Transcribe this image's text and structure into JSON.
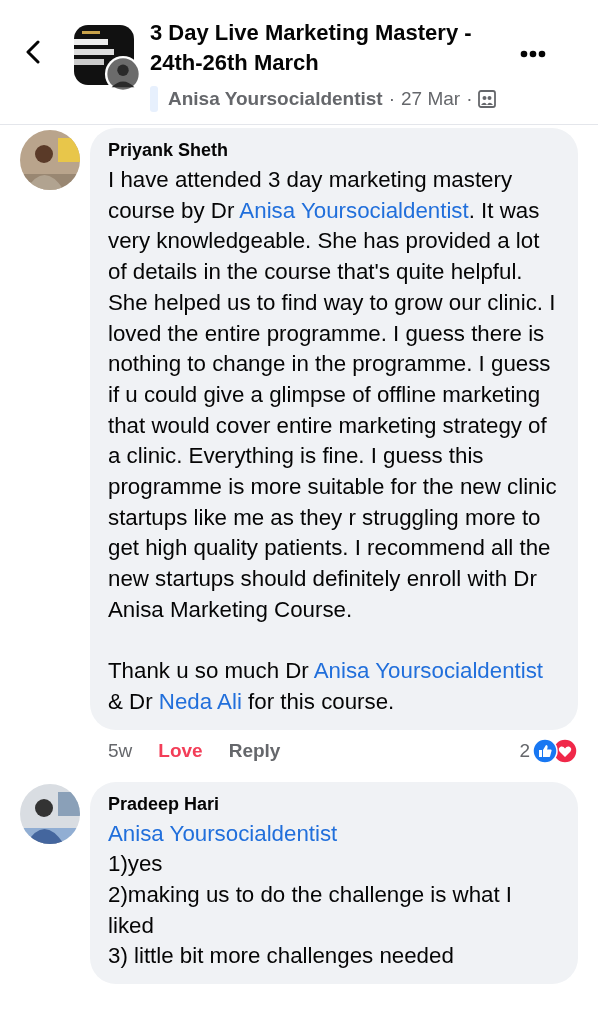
{
  "header": {
    "title": "3 Day Live Marketing Mastery - 24th-26th March",
    "author": "Anisa Yoursocialdentist",
    "separator_1": "·",
    "date": "27 Mar",
    "separator_2": "·"
  },
  "comments": [
    {
      "author": "Priyank Sheth",
      "paragraphs": [
        [
          {
            "kind": "text",
            "text": "I have attended 3 day marketing mastery course by Dr "
          },
          {
            "kind": "mention",
            "text": "Anisa Yoursocialdentist"
          },
          {
            "kind": "text",
            "text": ". It was very knowledgeable. She has provided a lot of details in the course that's quite helpful. She helped us to find way to grow our clinic. I loved the entire programme. I guess there is nothing to change in the programme. I guess if u could give a glimpse of offline marketing that would cover entire marketing strategy of a clinic. Everything is fine. I guess this programme is more suitable for the new clinic startups like me as they r struggling more to get high quality patients. I recommend all the new startups should definitely enroll with Dr Anisa Marketing Course."
          }
        ],
        [
          {
            "kind": "text",
            "text": "Thank u so much Dr "
          },
          {
            "kind": "mention",
            "text": "Anisa Yoursocialdentist"
          },
          {
            "kind": "text",
            "text": " & Dr "
          },
          {
            "kind": "mention",
            "text": "Neda Ali"
          },
          {
            "kind": "text",
            "text": " for this course."
          }
        ]
      ],
      "time": "5w",
      "love_label": "Love",
      "loved": true,
      "reply_label": "Reply",
      "reaction_count": "2"
    },
    {
      "author": "Pradeep Hari",
      "paragraphs": [
        [
          {
            "kind": "mention",
            "text": "Anisa Yoursocialdentist"
          }
        ],
        [
          {
            "kind": "text",
            "text": "1)yes"
          }
        ],
        [
          {
            "kind": "text",
            "text": "2)making us to do the challenge is what I liked"
          }
        ],
        [
          {
            "kind": "text",
            "text": "3) little bit more challenges needed"
          }
        ]
      ]
    }
  ]
}
